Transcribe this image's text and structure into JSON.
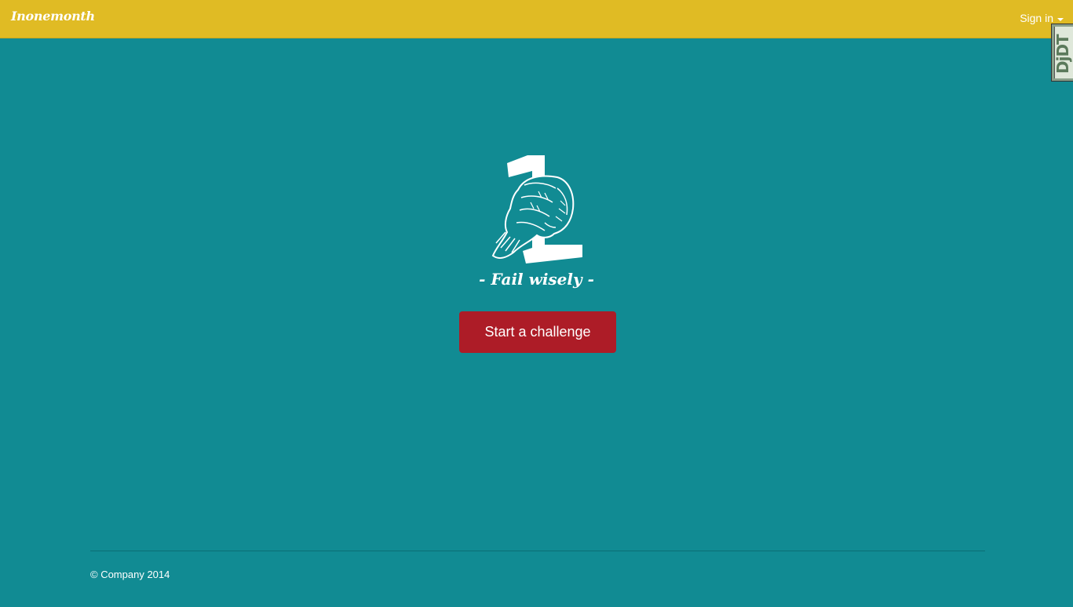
{
  "navbar": {
    "brand": "Inonemonth",
    "signin_label": "Sign in"
  },
  "debug_toolbar": {
    "label": "DjDT"
  },
  "hero": {
    "logo_icon": "fist-number-one-icon",
    "tagline": "- Fail wisely -",
    "cta_label": "Start a challenge"
  },
  "footer": {
    "copyright": "© Company 2014"
  },
  "colors": {
    "navbar": "#e0bb24",
    "background": "#118b93",
    "button": "#ad1c27"
  }
}
